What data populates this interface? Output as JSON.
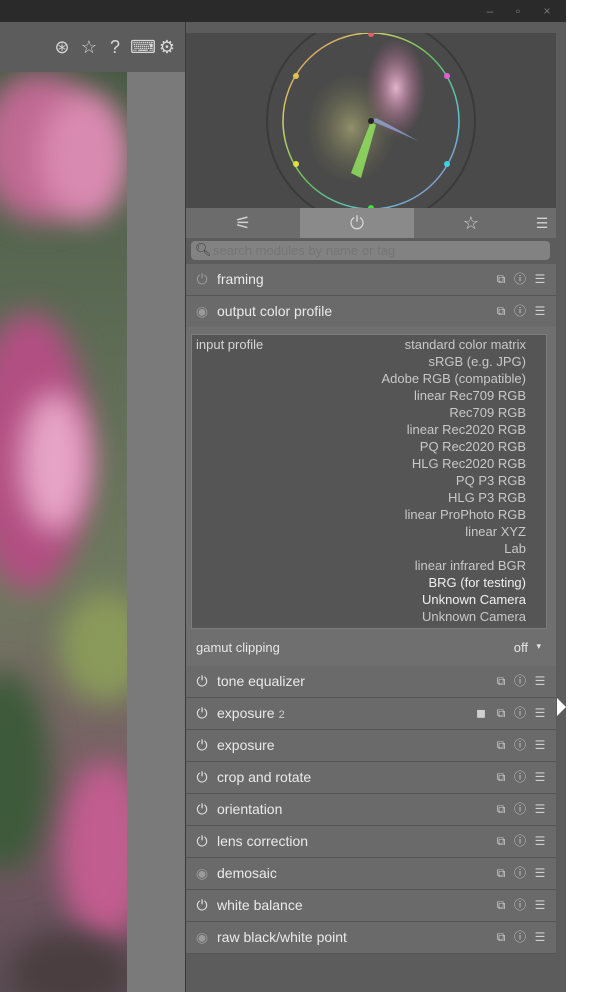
{
  "window": {
    "minimize": "‒",
    "maximize": "▫",
    "close": "×"
  },
  "toolbar_icons": [
    "presets-icon",
    "star-icon",
    "help-icon",
    "keyboard-icon",
    "gear-icon"
  ],
  "toolbar_glyphs": {
    "presets": "⊛",
    "star": "☆",
    "help": "?",
    "keyboard": "⌨",
    "gear": "⚙"
  },
  "tabs": [
    {
      "name": "tab-quick-access",
      "glyph": "⚟"
    },
    {
      "name": "tab-active-modules",
      "glyph": "⏻"
    },
    {
      "name": "tab-favorites",
      "glyph": "☆"
    }
  ],
  "tab_menu_glyph": "☰",
  "search": {
    "placeholder": "search modules by name or tag"
  },
  "modules_top": [
    {
      "id": "framing",
      "label": "framing",
      "state": "off"
    },
    {
      "id": "output-color-profile",
      "label": "output color profile",
      "state": "always-on"
    }
  ],
  "output_profile_dropdown": {
    "title": "input profile",
    "options": [
      "standard color matrix",
      "sRGB (e.g. JPG)",
      "Adobe RGB (compatible)",
      "linear Rec709 RGB",
      "Rec709 RGB",
      "linear Rec2020 RGB",
      "PQ Rec2020 RGB",
      "HLG Rec2020 RGB",
      "PQ P3 RGB",
      "HLG P3 RGB",
      "linear ProPhoto RGB",
      "linear XYZ",
      "Lab",
      "linear infrared BGR",
      "BRG (for testing)",
      "Unknown Camera",
      "Unknown Camera"
    ]
  },
  "gamut_clipping": {
    "label": "gamut clipping",
    "value": "off",
    "arrow": "▾"
  },
  "modules": [
    {
      "id": "tone-equalizer",
      "label": "tone equalizer",
      "instance": "",
      "state": "on"
    },
    {
      "id": "exposure-2",
      "label": "exposure",
      "instance": "2",
      "state": "on"
    },
    {
      "id": "exposure",
      "label": "exposure",
      "instance": "",
      "state": "on"
    },
    {
      "id": "crop-and-rotate",
      "label": "crop and rotate",
      "instance": "",
      "state": "on"
    },
    {
      "id": "orientation",
      "label": "orientation",
      "instance": "",
      "state": "on"
    },
    {
      "id": "lens-correction",
      "label": "lens correction",
      "instance": "",
      "state": "on"
    },
    {
      "id": "demosaic",
      "label": "demosaic",
      "instance": "",
      "state": "always-on"
    },
    {
      "id": "white-balance",
      "label": "white balance",
      "instance": "",
      "state": "on"
    },
    {
      "id": "raw-black-white-point",
      "label": "raw black/white point",
      "instance": "",
      "state": "always-on"
    }
  ],
  "module_glyphs": {
    "power": "⏻",
    "always_on": "◉",
    "presets": "⧉",
    "reset": "ⓘ",
    "menu": "☰",
    "mask": "◼"
  },
  "colors": {
    "panel": "#5c5c5c",
    "module_header": "#6a6a6a",
    "active_tab": "#8a8a8a",
    "text": "#eaeaea"
  }
}
